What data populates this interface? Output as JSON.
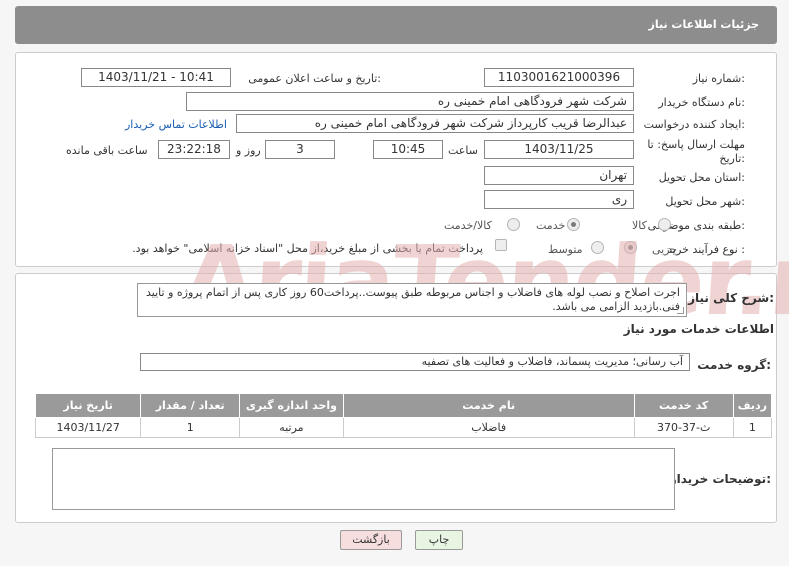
{
  "header": {
    "title": "جزئیات اطلاعات نیاز"
  },
  "fields": {
    "need_number": {
      "label": "شماره نیاز:",
      "value": "1103001621000396"
    },
    "announce_datetime": {
      "label": "تاریخ و ساعت اعلان عمومی:",
      "value": "1403/11/21 - 10:41"
    },
    "buyer_org": {
      "label": "نام دستگاه خریدار:",
      "value": "شرکت شهر فرودگاهی امام خمینی  ره"
    },
    "requester": {
      "label": "ایجاد کننده درخواست:",
      "value": "عبدالرضا قریب کارپرداز شرکت شهر فرودگاهی امام خمینی  ره"
    },
    "contact_link": "اطلاعات تماس خریدار",
    "deadline": {
      "label": "مهلت ارسال پاسخ: تا تاریخ:",
      "date": "1403/11/25",
      "time_label": "ساعت",
      "time": "10:45",
      "days": "3",
      "days_label": "روز و",
      "remaining": "23:22:18",
      "remaining_label": "ساعت باقی مانده"
    },
    "province": {
      "label": "استان محل تحویل:",
      "value": "تهران"
    },
    "city": {
      "label": "شهر محل تحویل:",
      "value": "ری"
    },
    "category": {
      "label": "طبقه بندی موضوعی:",
      "options": [
        "کالا",
        "خدمت",
        "کالا/خدمت"
      ],
      "selected": "خدمت"
    },
    "purchase_type": {
      "label": "نوع فرآیند خرید :",
      "options": [
        "جزیی",
        "متوسط"
      ],
      "selected": "جزیی",
      "payment_note": "پرداخت تمام یا بخشی از مبلغ خرید،از محل \"اسناد خزانه اسلامی\" خواهد بود."
    }
  },
  "summary": {
    "label": "شرح کلی نیاز:",
    "text": "اجرت اصلاح و نصب لوله های فاضلاب و اجناس مربوطه طبق پیوست..پرداخت60 روز کاری پس از اتمام پروژه و تایید فنی.بازدید الزامی می باشد."
  },
  "services": {
    "section_title": "اطلاعات خدمات مورد نیاز",
    "group_label": "گروه خدمت:",
    "group_value": "آب رسانی؛ مدیریت پسماند، فاضلاب و فعالیت های تصفیه",
    "columns": [
      "ردیف",
      "کد خدمت",
      "نام خدمت",
      "واحد اندازه گیری",
      "تعداد / مقدار",
      "تاریخ نیاز"
    ],
    "rows": [
      {
        "row": "1",
        "code": "ث-37-370",
        "name": "فاضلاب",
        "unit": "مرتبه",
        "qty": "1",
        "date": "1403/11/27"
      }
    ]
  },
  "buyer_notes": {
    "label": "توضیحات خریدار:",
    "value": ""
  },
  "buttons": {
    "print": "چاپ",
    "back": "بازگشت"
  },
  "watermark": "AriaTender.neT"
}
